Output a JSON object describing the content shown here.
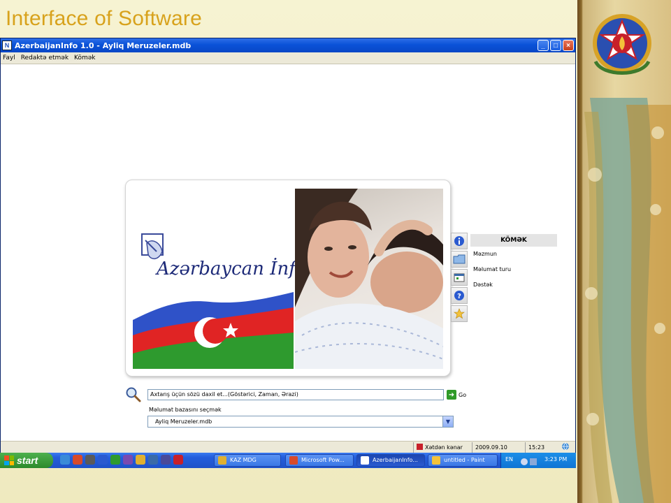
{
  "slide": {
    "title": "Interface of Software"
  },
  "window": {
    "title": "AzerbaijanInfo 1.0 - Ayliq Meruzeler.mdb",
    "icon_glyph": "N",
    "buttons": {
      "minimize": "_",
      "maximize": "□",
      "close": "×"
    }
  },
  "menu": {
    "items": [
      "Fayl",
      "Redaktə etmək",
      "Kömək"
    ]
  },
  "banner": {
    "brand": "Azərbaycan İnfo"
  },
  "help": {
    "header": "KÖMƏK",
    "items": [
      "Məzmun",
      "Məlumat turu",
      "Dəstək"
    ]
  },
  "search": {
    "placeholder": "Axtarış üçün sözü daxil et...(Göstərici, Zaman, Ərazi)",
    "go_label": "Go",
    "go_arrow": "➜"
  },
  "database": {
    "label": "Məlumat bazasını seçmək",
    "selected": "Ayliq Meruzeler.mdb",
    "arrow": "▼"
  },
  "status": {
    "exit": "Xətdən kənar",
    "date": "2009.09.10",
    "time": "15:23"
  },
  "taskbar": {
    "start": "start",
    "tasks": [
      "KAZ MDG",
      "Microsoft Pow...",
      "AzerbaijanInfo...",
      "untitled - Paint"
    ],
    "lang": "EN",
    "clock": "3:23 PM"
  },
  "colors": {
    "title_gold": "#d8a21c",
    "titlebar_blue": "#0a52d8",
    "flag_blue": "#2f52c8",
    "flag_red": "#e02424",
    "flag_green": "#2e9a2e"
  }
}
